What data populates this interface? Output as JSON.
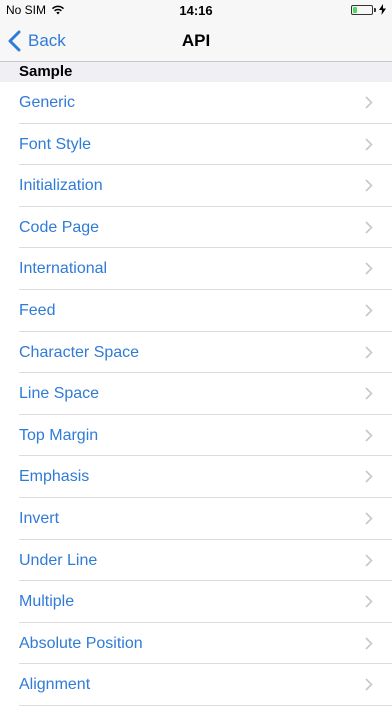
{
  "status_bar": {
    "carrier": "No SIM",
    "time": "14:16",
    "battery_level": 0.2,
    "icons": [
      "wifi-icon",
      "battery-icon",
      "charging-icon"
    ]
  },
  "nav": {
    "back_label": "Back",
    "title": "API"
  },
  "section": {
    "header": "Sample"
  },
  "items": [
    {
      "label": "Generic"
    },
    {
      "label": "Font Style"
    },
    {
      "label": "Initialization"
    },
    {
      "label": "Code Page"
    },
    {
      "label": "International"
    },
    {
      "label": "Feed"
    },
    {
      "label": "Character Space"
    },
    {
      "label": "Line Space"
    },
    {
      "label": "Top Margin"
    },
    {
      "label": "Emphasis"
    },
    {
      "label": "Invert"
    },
    {
      "label": "Under Line"
    },
    {
      "label": "Multiple"
    },
    {
      "label": "Absolute Position"
    },
    {
      "label": "Alignment"
    }
  ],
  "colors": {
    "accent": "#2f7bd8",
    "chevron": "#c7c7cc",
    "section_bg": "#efeff4"
  }
}
